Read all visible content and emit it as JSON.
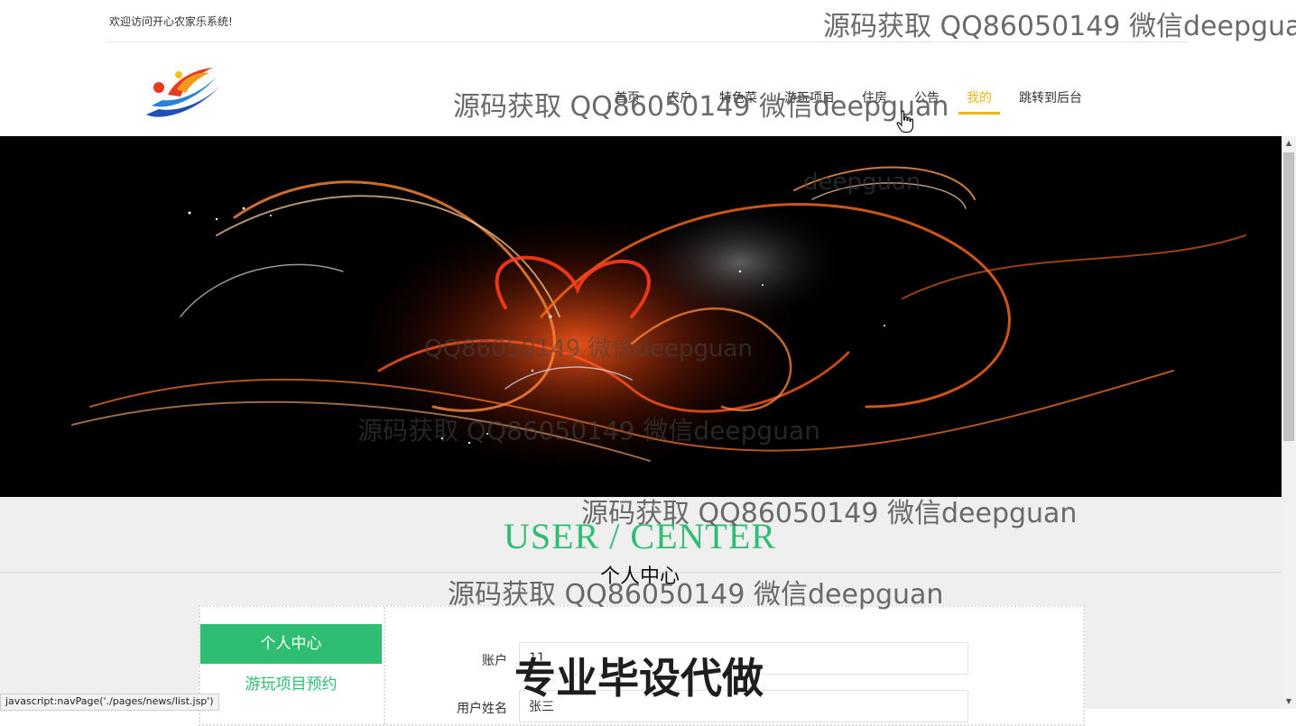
{
  "topbar": {
    "welcome_text": "欢迎访问开心农家乐系统!"
  },
  "nav": {
    "items": [
      {
        "label": "首页"
      },
      {
        "label": "农户"
      },
      {
        "label": "特色菜"
      },
      {
        "label": "游玩项目"
      },
      {
        "label": "住房"
      },
      {
        "label": "公告"
      },
      {
        "label": "我的"
      },
      {
        "label": "跳转到后台"
      }
    ],
    "active_index": 6,
    "active_color": "#e8b71a"
  },
  "section": {
    "title_en": "USER / CENTER",
    "title_cn": "个人中心",
    "accent_color": "#2fbc73"
  },
  "sidebar": {
    "items": [
      {
        "label": "个人中心"
      },
      {
        "label": "游玩项目预约"
      }
    ]
  },
  "form": {
    "account_label": "账户",
    "account_value": "11",
    "name_label": "用户姓名",
    "name_value": "张三"
  },
  "watermarks": {
    "text": "源码获取 QQ86050149 微信deepguan",
    "fragment_1": "deepguan",
    "fragment_2": "QQ86050149 微信deepguan",
    "stamp": "专业毕设代做"
  },
  "statusbar": {
    "text": "javascript:navPage('./pages/news/list.jsp')"
  }
}
